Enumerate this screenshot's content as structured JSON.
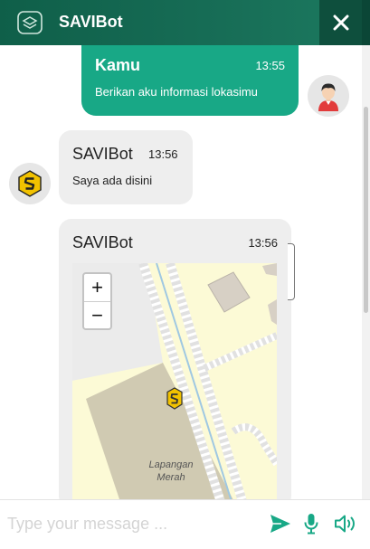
{
  "header": {
    "title": "SAVIBot",
    "logo_icon": "savibot-logo-icon",
    "close_icon": "close-icon",
    "colors": {
      "header": "#176d56",
      "close_bg": "#0e4f3d"
    }
  },
  "messages": [
    {
      "sender": "Kamu",
      "time": "13:55",
      "text": "Berikan aku informasi lokasimu",
      "avatar_icon": "user-avatar-icon",
      "bubble_color": "#18a886"
    },
    {
      "sender": "SAVIBot",
      "time": "13:56",
      "text": "Saya ada disini",
      "avatar_icon": "savibot-avatar-icon",
      "bubble_color": "#eeeeee"
    },
    {
      "sender": "SAVIBot",
      "time": "13:56",
      "map": {
        "zoom_in": "+",
        "zoom_out": "−",
        "place_label": "Lapangan Merah",
        "marker_icon": "location-marker-icon"
      }
    }
  ],
  "input": {
    "placeholder": "Type your message ...",
    "value": "",
    "send_icon": "send-icon",
    "mic_icon": "microphone-icon",
    "speaker_icon": "speaker-icon",
    "accent": "#18a886"
  }
}
